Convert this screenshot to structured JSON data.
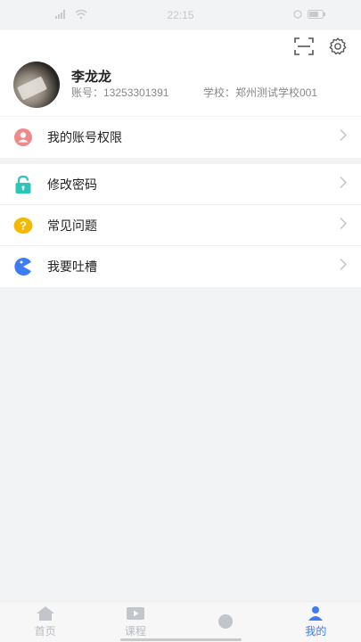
{
  "status_bar": {
    "time": "22:15",
    "left_icons": [
      "signal-icon",
      "hd-icon",
      "wifi-icon"
    ],
    "right_icons": [
      "nfc-icon",
      "alarm-icon",
      "battery-icon"
    ]
  },
  "profile": {
    "name": "李龙龙",
    "account": "账号：13253301391",
    "school": "学校：郑州测试学校001"
  },
  "top_actions": [
    "scan-icon",
    "settings-icon"
  ],
  "menu_group_1": [
    {
      "label": "我的账号权限",
      "icon": "person-icon",
      "color": "#f08a8a"
    }
  ],
  "menu_group_2": [
    {
      "label": "修改密码",
      "icon": "lock-icon",
      "color": "#2bc6b8"
    },
    {
      "label": "常见问题",
      "icon": "question-icon",
      "color": "#f5b800"
    },
    {
      "label": "我要吐槽",
      "icon": "pacman-icon",
      "color": "#3d7cf4"
    }
  ],
  "tabs": [
    {
      "label": "首页",
      "icon": "home-icon",
      "active": false
    },
    {
      "label": "课程",
      "icon": "video-icon",
      "active": false
    },
    {
      "label": "",
      "icon": "discover-icon",
      "active": false
    },
    {
      "label": "我的",
      "icon": "user-icon",
      "active": true
    }
  ],
  "colors": {
    "accent": "#3d7cf4",
    "background": "#f2f3f5"
  }
}
